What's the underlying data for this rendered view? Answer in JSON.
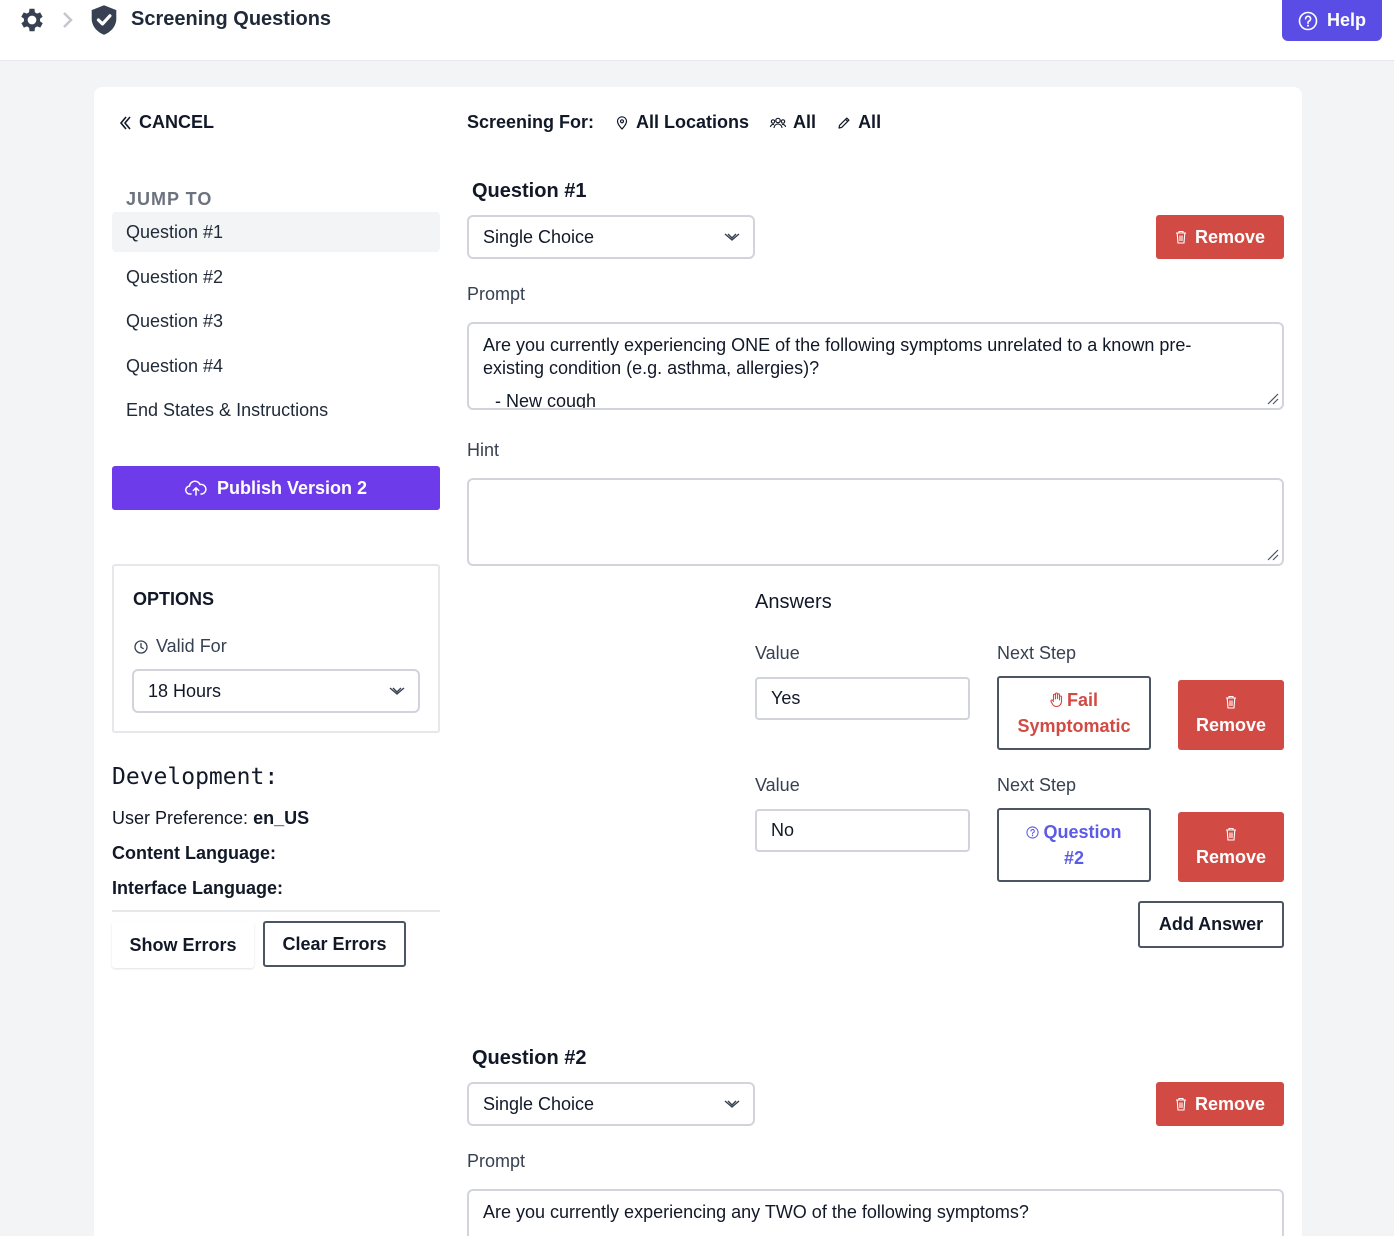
{
  "header": {
    "title": "Screening Questions",
    "help_label": "Help"
  },
  "sidebar": {
    "cancel_label": "CANCEL",
    "jump_title": "JUMP TO",
    "items": [
      {
        "label": "Question #1",
        "active": true
      },
      {
        "label": "Question #2",
        "active": false
      },
      {
        "label": "Question #3",
        "active": false
      },
      {
        "label": "Question #4",
        "active": false
      },
      {
        "label": "End States & Instructions",
        "active": false
      }
    ],
    "publish_label": "Publish Version 2",
    "options": {
      "title": "OPTIONS",
      "valid_for_label": "Valid For",
      "valid_for_value": "18 Hours"
    },
    "development": {
      "title": "Development:",
      "user_pref_label": "User Preference:",
      "user_pref_value": "en_US",
      "content_lang_label": "Content Language:",
      "interface_lang_label": "Interface Language:",
      "show_errors": "Show Errors",
      "clear_errors": "Clear Errors"
    }
  },
  "screening": {
    "label": "Screening For:",
    "location": "All Locations",
    "group": "All",
    "role": "All"
  },
  "questions": [
    {
      "title": "Question #1",
      "type": "Single Choice",
      "remove_label": "Remove",
      "prompt_label": "Prompt",
      "prompt": "Are you currently experiencing ONE of the following symptoms unrelated to a known pre-existing condition (e.g. asthma, allergies)?",
      "prompt_cut": "- New cough",
      "hint_label": "Hint",
      "hint": "",
      "answers_label": "Answers",
      "answers": [
        {
          "value_label": "Value",
          "value": "Yes",
          "next_label": "Next Step",
          "next_line1": "Fail",
          "next_line2": "Symptomatic",
          "next_kind": "fail",
          "remove_label": "Remove"
        },
        {
          "value_label": "Value",
          "value": "No",
          "next_label": "Next Step",
          "next_line1": "Question",
          "next_line2": "#2",
          "next_kind": "question",
          "remove_label": "Remove"
        }
      ],
      "add_answer_label": "Add Answer"
    },
    {
      "title": "Question #2",
      "type": "Single Choice",
      "remove_label": "Remove",
      "prompt_label": "Prompt",
      "prompt": "Are you currently experiencing any TWO of the following symptoms?"
    }
  ],
  "colors": {
    "accent": "#5a4de6",
    "publish": "#6d3bea",
    "danger": "#d14a44",
    "link": "#5b5be6"
  }
}
